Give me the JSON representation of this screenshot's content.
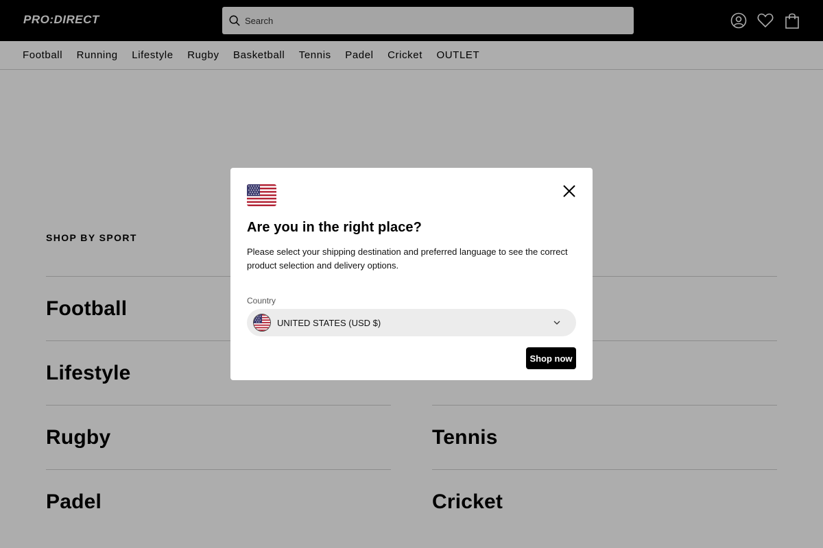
{
  "header": {
    "logo_text": "PRO:DIRECT",
    "search_placeholder": "Search",
    "icons": [
      "account-icon",
      "wishlist-heart-icon",
      "bag-icon"
    ]
  },
  "nav": {
    "items": [
      "Football",
      "Running",
      "Lifestyle",
      "Rugby",
      "Basketball",
      "Tennis",
      "Padel",
      "Cricket",
      "OUTLET"
    ]
  },
  "main": {
    "section_title": "SHOP BY SPORT",
    "sports_left": [
      "Football",
      "Lifestyle",
      "Rugby",
      "Padel"
    ],
    "sports_right": [
      "Tennis",
      "Cricket"
    ]
  },
  "modal": {
    "title": "Are you in the right place?",
    "description": "Please select your shipping destination and preferred language to see the correct product selection and delivery options.",
    "country_label": "Country",
    "country_value": "UNITED STATES (USD $)",
    "shop_button": "Shop now",
    "flag": "us-flag-icon"
  },
  "colors": {
    "header_bg": "#000000",
    "overlay": "rgba(0,0,0,0.32)",
    "button_bg": "#000000",
    "select_bg": "#ececec"
  }
}
